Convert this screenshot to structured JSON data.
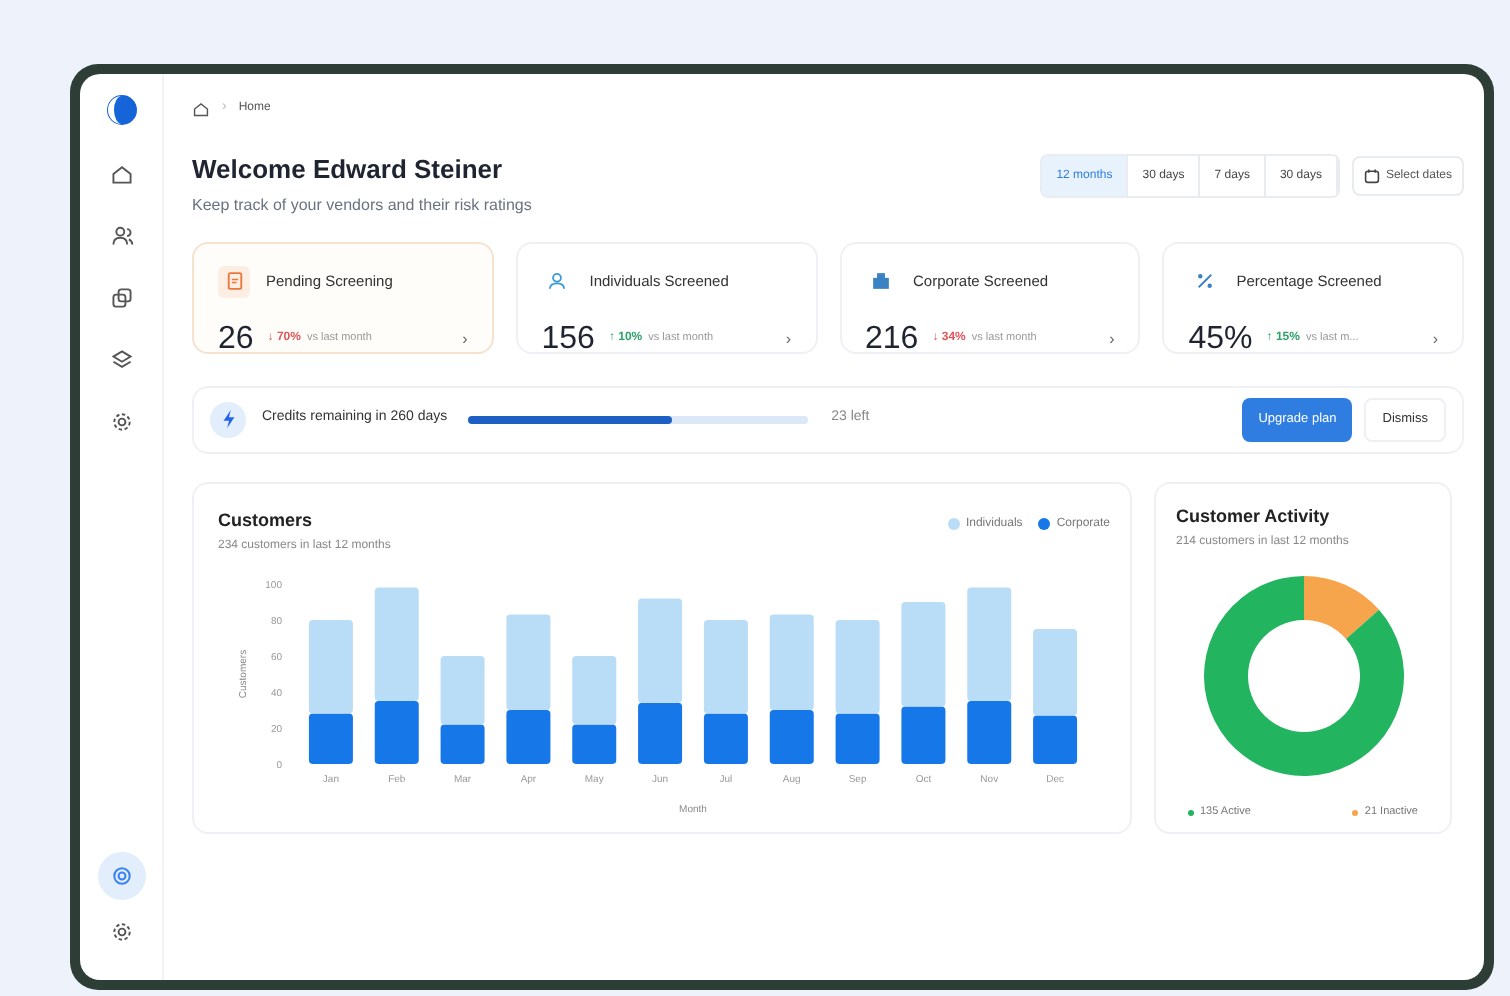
{
  "sidebar": {
    "items": [
      {
        "selected": false
      },
      {
        "selected": false
      },
      {
        "selected": false
      },
      {
        "selected": false
      },
      {
        "selected": false
      }
    ],
    "bottom_items": [
      {
        "selected": true
      },
      {
        "selected": false
      }
    ]
  },
  "breadcrumb": {
    "separator": "›",
    "items": [
      "Home"
    ]
  },
  "header": {
    "title": "Welcome Edward Steiner",
    "subtitle": "Keep track of your vendors and their risk ratings"
  },
  "range_tabs": [
    {
      "label": "12 months",
      "selected": true
    },
    {
      "label": "30 days",
      "selected": false
    },
    {
      "label": "7 days",
      "selected": false
    },
    {
      "label": "30 days",
      "selected": false
    }
  ],
  "date_button": "Select dates",
  "stat_cards": [
    {
      "title": "Pending Screening",
      "value": "26",
      "change": "↓ 70%",
      "color": "#e0565b",
      "comparison": "vs last month",
      "chevron": "›",
      "highlighted": true
    },
    {
      "title": "Individuals Screened",
      "value": "156",
      "change": "↑ 10%",
      "color": "#2fa36b",
      "comparison": "vs last month",
      "chevron": "›",
      "highlighted": false
    },
    {
      "title": "Corporate Screened",
      "value": "216",
      "change": "↓ 34%",
      "color": "#e0565b",
      "comparison": "vs last month",
      "chevron": "›",
      "highlighted": false
    },
    {
      "title": "Percentage Screened",
      "value": "45%",
      "change": "↑ 15%",
      "color": "#2fa36b",
      "comparison": "vs last m...",
      "chevron": "›",
      "highlighted": false
    }
  ],
  "credits": {
    "text": "Credits remaining in 260 days",
    "level": 0.6,
    "remaining": "23 left",
    "buttons": [
      {
        "label": "Upgrade plan",
        "kind": "primary"
      },
      {
        "label": "Dismiss",
        "kind": "plain"
      }
    ]
  },
  "customers": {
    "title": "Customers",
    "subtitle": "234 customers in last 12 months",
    "chart_data": {
      "type": "bar",
      "stacked": true,
      "xlabel": "Month",
      "ylabel": "Customers",
      "categories": [
        "Jan",
        "Feb",
        "Mar",
        "Apr",
        "May",
        "Jun",
        "Jul",
        "Aug",
        "Sep",
        "Oct",
        "Nov",
        "Dec"
      ],
      "series": [
        {
          "name": "Corporate",
          "color": "#1677e8",
          "values": [
            28,
            35,
            22,
            30,
            22,
            34,
            28,
            30,
            28,
            32,
            35,
            27
          ]
        },
        {
          "name": "Individuals",
          "color": "#b9dcf7",
          "values": [
            52,
            63,
            38,
            53,
            38,
            58,
            52,
            53,
            52,
            58,
            63,
            48
          ]
        }
      ],
      "ylim": [
        0,
        100
      ],
      "yticks": [
        0,
        20,
        40,
        60,
        80,
        100
      ]
    }
  },
  "activity": {
    "title": "Customer Activity",
    "subtitle": "214 customers in last 12 months",
    "chart_data": {
      "type": "donut",
      "values": [
        86.5,
        13.5
      ]
    },
    "legend": [
      {
        "label": "135 Active",
        "color": "#22b45e"
      },
      {
        "label": "21 Inactive",
        "color": "#f6a54c"
      }
    ]
  }
}
